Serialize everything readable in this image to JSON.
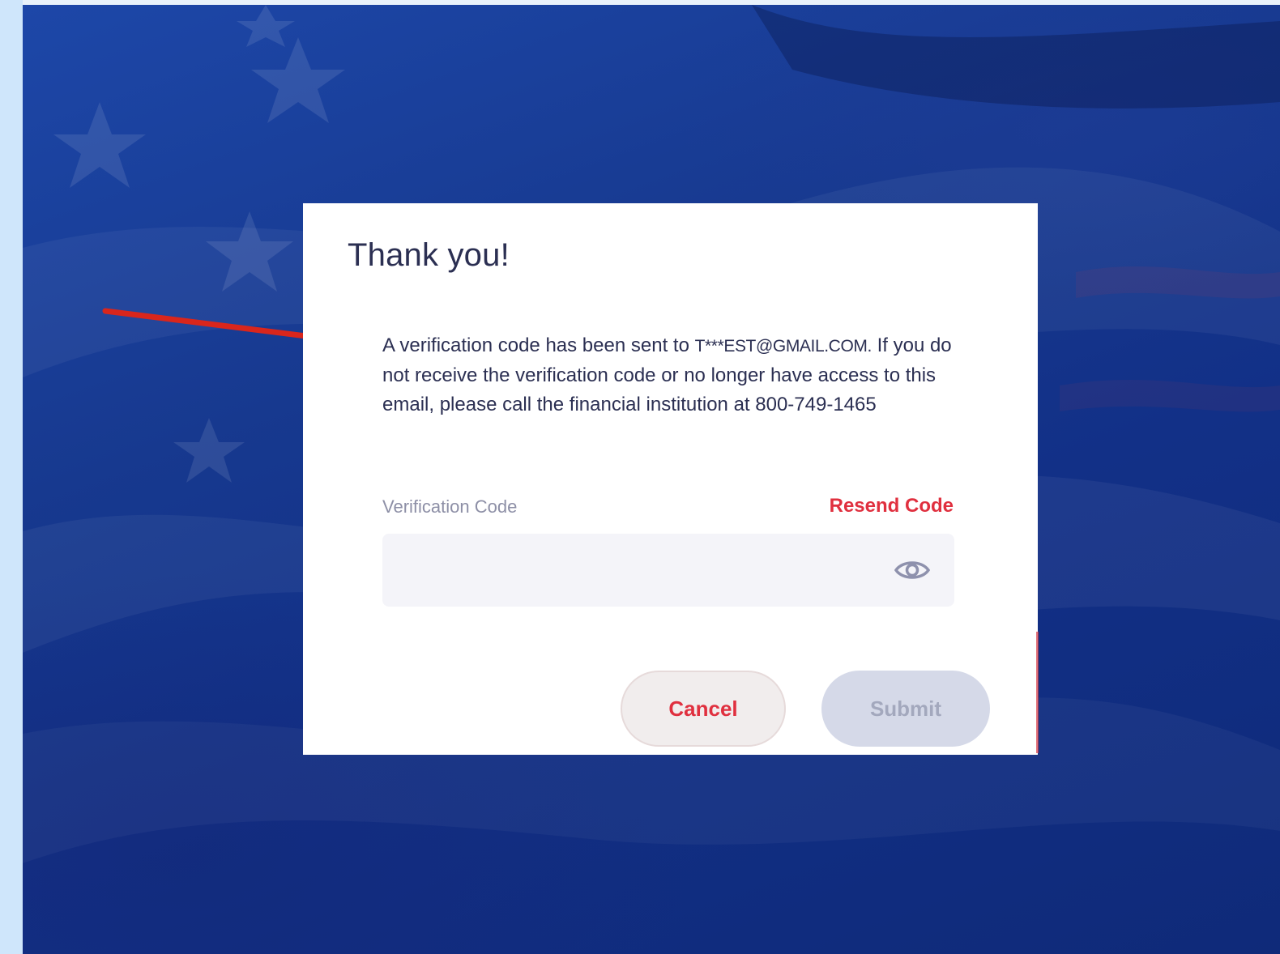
{
  "modal": {
    "title": "Thank you!",
    "message_prefix": "A verification code has been sent to ",
    "email": "T***EST@GMAIL.COM.",
    "message_rest": "If you do not receive the verification code or no longer have access to this email, please call the financial institution at 800-749-1465",
    "field": {
      "label": "Verification Code",
      "value": "",
      "placeholder": "",
      "toggle_icon": "eye-icon"
    },
    "resend_label": "Resend Code",
    "buttons": {
      "cancel_label": "Cancel",
      "submit_label": "Submit"
    }
  },
  "annotation": {
    "icon": "red-arrow-icon"
  },
  "colors": {
    "accent_red": "#e0303f",
    "title_text": "#2b2f52",
    "background_blue": "#17398f",
    "submit_disabled_bg": "#d5d9e8",
    "annotation_arrow": "#d9261c"
  }
}
